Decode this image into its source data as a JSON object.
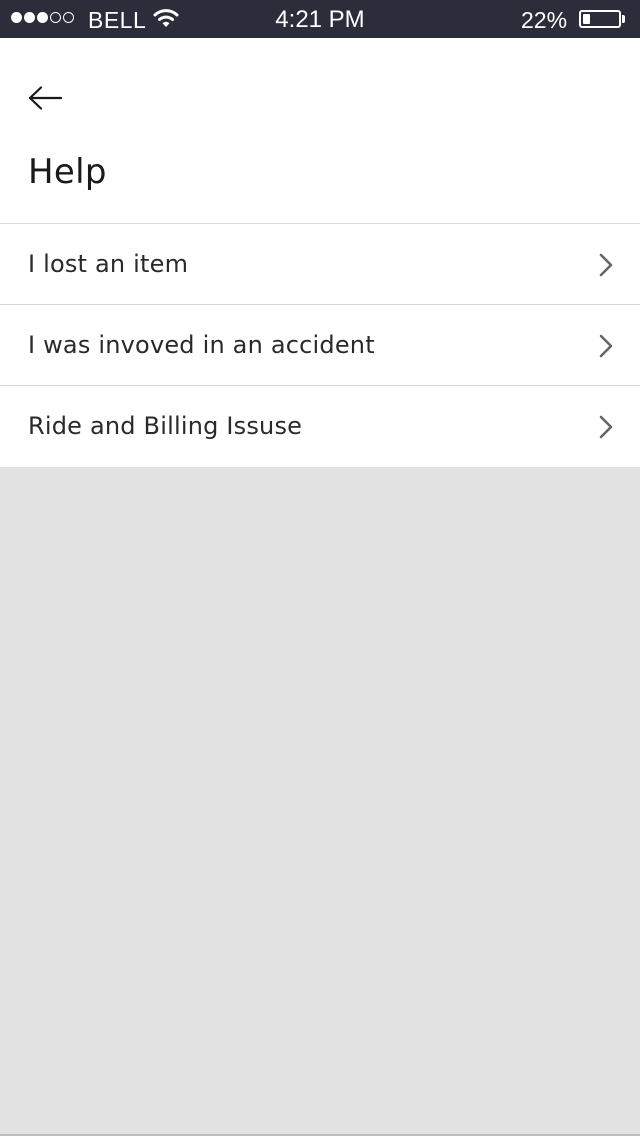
{
  "status_bar": {
    "carrier": "BELL",
    "time": "4:21 PM",
    "battery_percent": "22%",
    "battery_level": 0.22,
    "signal_bars_filled": 3,
    "signal_bars_total": 5,
    "background_color": "#2c2d3b"
  },
  "header": {
    "back_icon": "arrow-left-icon",
    "title": "Help"
  },
  "menu": {
    "items": [
      {
        "label": "I lost an item",
        "icon": "chevron-right-icon"
      },
      {
        "label": "I was invoved in an accident",
        "icon": "chevron-right-icon"
      },
      {
        "label": "Ride and Billing Issuse",
        "icon": "chevron-right-icon"
      }
    ]
  },
  "colors": {
    "background": "#e2e2e2",
    "surface": "#ffffff",
    "text": "#2a2a2a",
    "chevron": "#666666"
  }
}
